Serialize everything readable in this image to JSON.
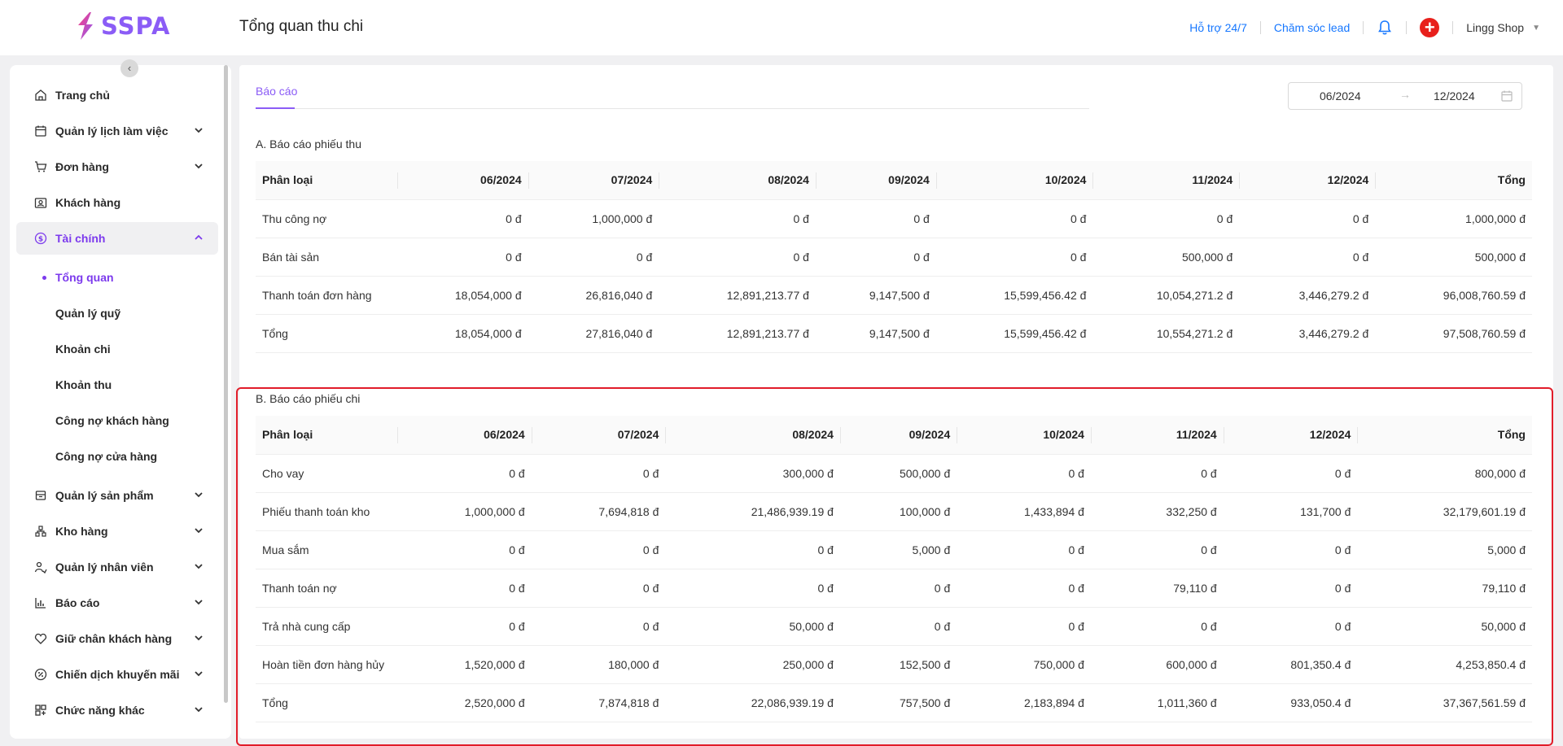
{
  "brand": {
    "name": "SSPA",
    "accent": "#8b5cf6"
  },
  "header": {
    "title": "Tổng quan thu chi",
    "support_link": "Hỗ trợ 24/7",
    "lead_link": "Chăm sóc lead",
    "shop_name": "Lingg Shop",
    "plus_label": "+",
    "icons": [
      "bell-icon",
      "plus-icon",
      "caret-down-icon"
    ]
  },
  "sidebar": {
    "collapse_label": "‹",
    "items": [
      {
        "label": "Trang chủ",
        "icon": "home-icon",
        "expandable": false
      },
      {
        "label": "Quản lý lịch làm việc",
        "icon": "calendar-icon",
        "expandable": true
      },
      {
        "label": "Đơn hàng",
        "icon": "cart-icon",
        "expandable": true
      },
      {
        "label": "Khách hàng",
        "icon": "contact-icon",
        "expandable": false
      },
      {
        "label": "Tài chính",
        "icon": "dollar-icon",
        "expandable": true,
        "active": true
      },
      {
        "label": "Quản lý sản phẩm",
        "icon": "box-icon",
        "expandable": true
      },
      {
        "label": "Kho hàng",
        "icon": "warehouse-icon",
        "expandable": true
      },
      {
        "label": "Quản lý nhân viên",
        "icon": "users-icon",
        "expandable": true
      },
      {
        "label": "Báo cáo",
        "icon": "chart-icon",
        "expandable": true
      },
      {
        "label": "Giữ chân khách hàng",
        "icon": "heart-icon",
        "expandable": true
      },
      {
        "label": "Chiến dịch khuyến mãi",
        "icon": "promo-icon",
        "expandable": true
      },
      {
        "label": "Chức năng khác",
        "icon": "grid-icon",
        "expandable": true
      }
    ],
    "sub_items": [
      {
        "label": "Tổng quan",
        "active": true
      },
      {
        "label": "Quản lý quỹ"
      },
      {
        "label": "Khoản chi"
      },
      {
        "label": "Khoản thu"
      },
      {
        "label": "Công nợ khách hàng"
      },
      {
        "label": "Công nợ cửa hàng"
      }
    ]
  },
  "main": {
    "tab_label": "Báo cáo",
    "date_from": "06/2024",
    "date_arrow": "→",
    "date_to": "12/2024",
    "columns": [
      "Phân loại",
      "06/2024",
      "07/2024",
      "08/2024",
      "09/2024",
      "10/2024",
      "11/2024",
      "12/2024",
      "Tổng"
    ],
    "section_a": {
      "title": "A. Báo cáo phiếu thu",
      "rows": [
        [
          "Thu công nợ",
          "0 đ",
          "1,000,000 đ",
          "0 đ",
          "0 đ",
          "0 đ",
          "0 đ",
          "0 đ",
          "1,000,000 đ"
        ],
        [
          "Bán tài sản",
          "0 đ",
          "0 đ",
          "0 đ",
          "0 đ",
          "0 đ",
          "500,000 đ",
          "0 đ",
          "500,000 đ"
        ],
        [
          "Thanh toán đơn hàng",
          "18,054,000 đ",
          "26,816,040 đ",
          "12,891,213.77 đ",
          "9,147,500 đ",
          "15,599,456.42 đ",
          "10,054,271.2 đ",
          "3,446,279.2 đ",
          "96,008,760.59 đ"
        ],
        [
          "Tổng",
          "18,054,000 đ",
          "27,816,040 đ",
          "12,891,213.77 đ",
          "9,147,500 đ",
          "15,599,456.42 đ",
          "10,554,271.2 đ",
          "3,446,279.2 đ",
          "97,508,760.59 đ"
        ]
      ]
    },
    "section_b": {
      "title": "B. Báo cáo phiếu chi",
      "rows": [
        [
          "Cho vay",
          "0 đ",
          "0 đ",
          "300,000 đ",
          "500,000 đ",
          "0 đ",
          "0 đ",
          "0 đ",
          "800,000 đ"
        ],
        [
          "Phiếu thanh toán kho",
          "1,000,000 đ",
          "7,694,818 đ",
          "21,486,939.19 đ",
          "100,000 đ",
          "1,433,894 đ",
          "332,250 đ",
          "131,700 đ",
          "32,179,601.19 đ"
        ],
        [
          "Mua sắm",
          "0 đ",
          "0 đ",
          "0 đ",
          "5,000 đ",
          "0 đ",
          "0 đ",
          "0 đ",
          "5,000 đ"
        ],
        [
          "Thanh toán nợ",
          "0 đ",
          "0 đ",
          "0 đ",
          "0 đ",
          "0 đ",
          "79,110 đ",
          "0 đ",
          "79,110 đ"
        ],
        [
          "Trả nhà cung cấp",
          "0 đ",
          "0 đ",
          "50,000 đ",
          "0 đ",
          "0 đ",
          "0 đ",
          "0 đ",
          "50,000 đ"
        ],
        [
          "Hoàn tiền đơn hàng hủy",
          "1,520,000 đ",
          "180,000 đ",
          "250,000 đ",
          "152,500 đ",
          "750,000 đ",
          "600,000 đ",
          "801,350.4 đ",
          "4,253,850.4 đ"
        ],
        [
          "Tổng",
          "2,520,000 đ",
          "7,874,818 đ",
          "22,086,939.19 đ",
          "757,500 đ",
          "2,183,894 đ",
          "1,011,360 đ",
          "933,050.4 đ",
          "37,367,561.59 đ"
        ]
      ]
    }
  }
}
